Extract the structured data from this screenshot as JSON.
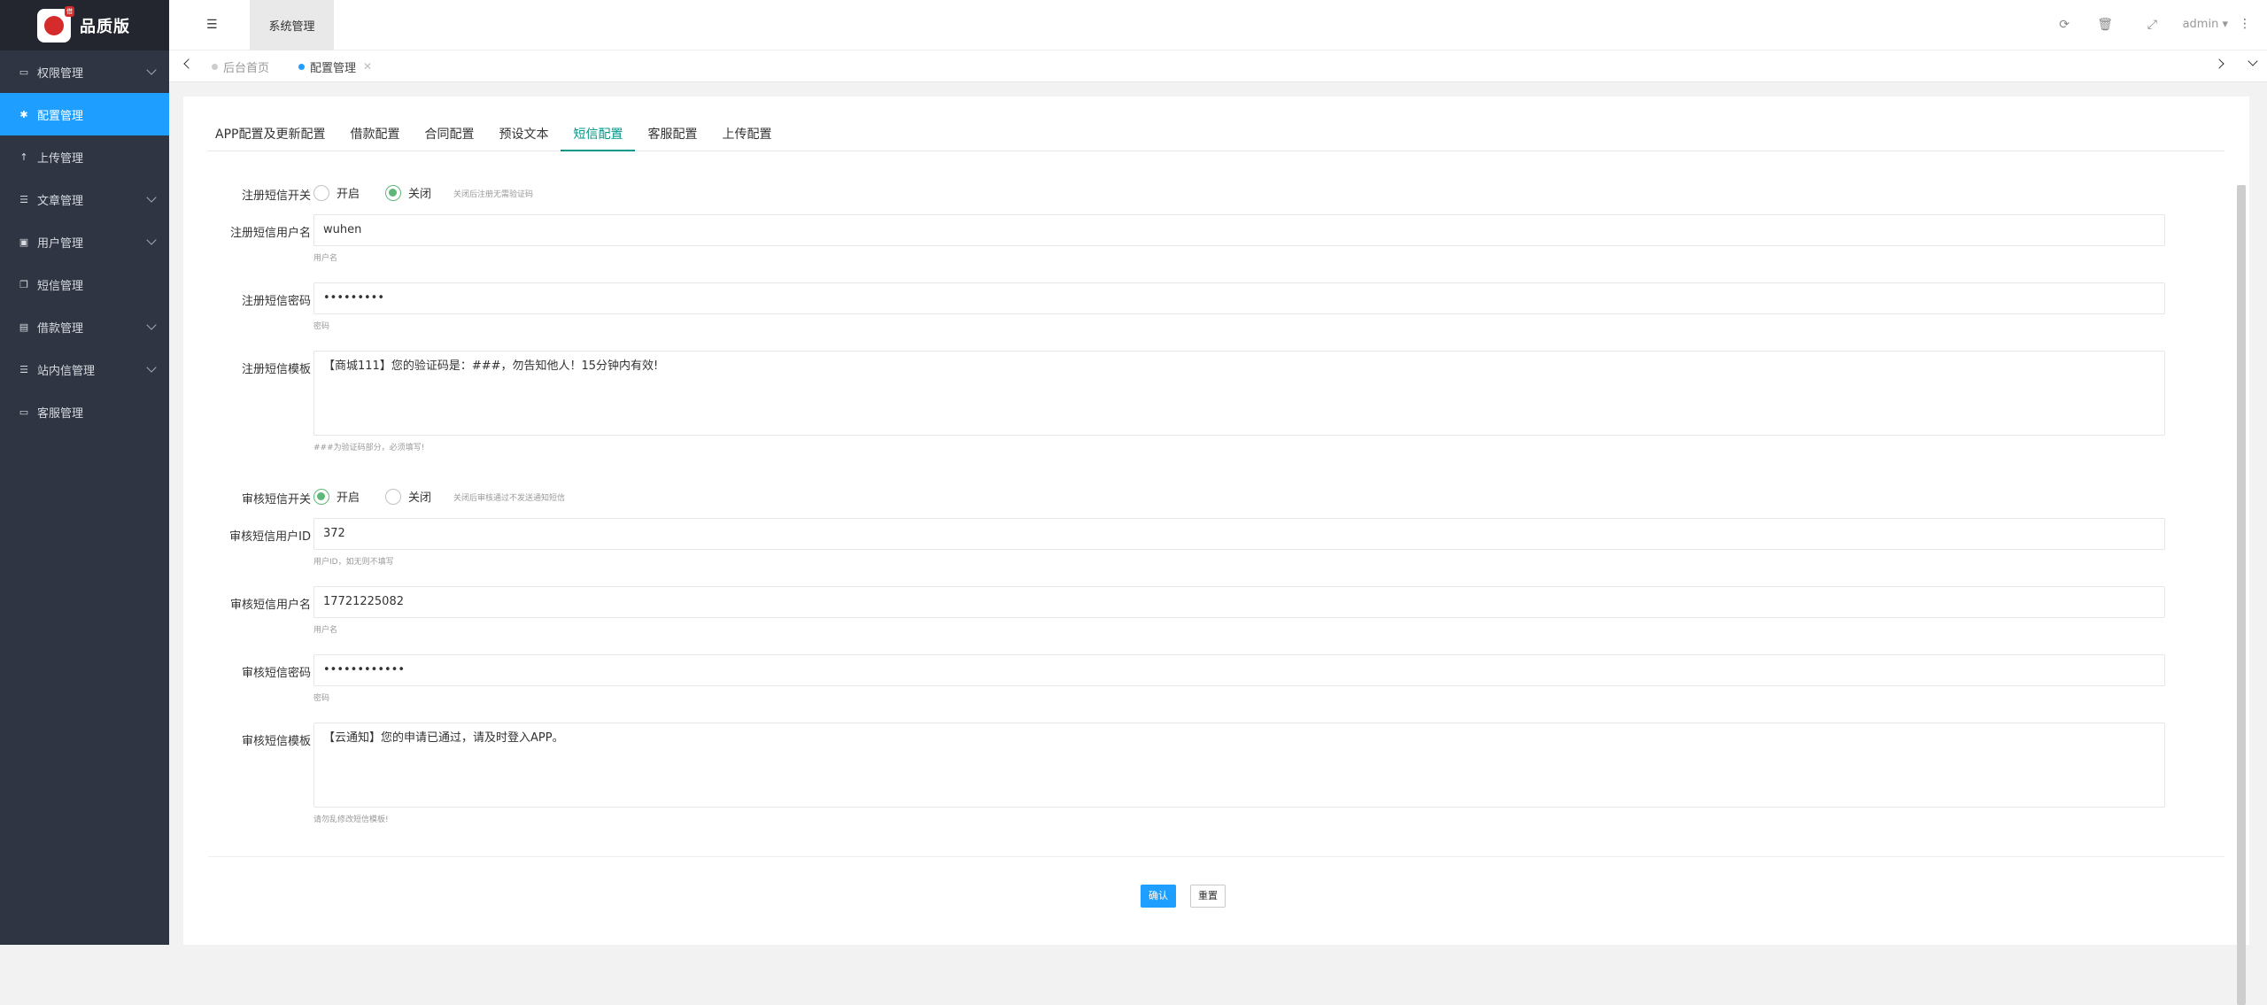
{
  "brand": {
    "title": "品质版",
    "logo_tag": "借"
  },
  "sidebar": {
    "items": [
      {
        "label": "权限管理",
        "icon": "laptop-icon",
        "has_children": true
      },
      {
        "label": "配置管理",
        "icon": "gear-icon",
        "active": true
      },
      {
        "label": "上传管理",
        "icon": "upload-icon"
      },
      {
        "label": "文章管理",
        "icon": "list-icon",
        "has_children": true
      },
      {
        "label": "用户管理",
        "icon": "user-card-icon",
        "has_children": true
      },
      {
        "label": "短信管理",
        "icon": "copy-icon"
      },
      {
        "label": "借款管理",
        "icon": "money-icon",
        "has_children": true
      },
      {
        "label": "站内信管理",
        "icon": "list-icon",
        "has_children": true
      },
      {
        "label": "客服管理",
        "icon": "monitor-icon"
      }
    ]
  },
  "topbar": {
    "menu_tab": "系统管理",
    "user": "admin"
  },
  "page_tabs": [
    {
      "label": "后台首页",
      "active": false
    },
    {
      "label": "配置管理",
      "active": true
    }
  ],
  "form_tabs": [
    "APP配置及更新配置",
    "借款配置",
    "合同配置",
    "预设文本",
    "短信配置",
    "客服配置",
    "上传配置"
  ],
  "active_form_tab": "短信配置",
  "form": {
    "reg_switch": {
      "label": "注册短信开关",
      "on": "开启",
      "off": "关闭",
      "hint": "关闭后注册无需验证码",
      "value": "off"
    },
    "reg_user": {
      "label": "注册短信用户名",
      "value": "wuhen",
      "help": "用户名"
    },
    "reg_pass": {
      "label": "注册短信密码",
      "value": "•••••••••",
      "help": "密码"
    },
    "reg_tpl": {
      "label": "注册短信模板",
      "value": "【商城111】您的验证码是：###，勿告知他人！15分钟内有效!",
      "help": "###为验证码部分，必须填写!"
    },
    "audit_switch": {
      "label": "审核短信开关",
      "on": "开启",
      "off": "关闭",
      "hint": "关闭后审核通过不发送通知短信",
      "value": "on"
    },
    "audit_uid": {
      "label": "审核短信用户ID",
      "value": "372",
      "help": "用户ID，如无则不填写"
    },
    "audit_user": {
      "label": "审核短信用户名",
      "value": "17721225082",
      "help": "用户名"
    },
    "audit_pass": {
      "label": "审核短信密码",
      "value": "••••••••••••",
      "help": "密码"
    },
    "audit_tpl": {
      "label": "审核短信模板",
      "value": "【云通知】您的申请已通过，请及时登入APP。",
      "help": "请勿乱修改短信模板!"
    }
  },
  "buttons": {
    "confirm": "确认",
    "reset": "重置"
  },
  "colors": {
    "sidebar_bg": "#2f3542",
    "active_blue": "#1e9fff",
    "tab_green": "#009688",
    "radio_green": "#5fb878"
  }
}
